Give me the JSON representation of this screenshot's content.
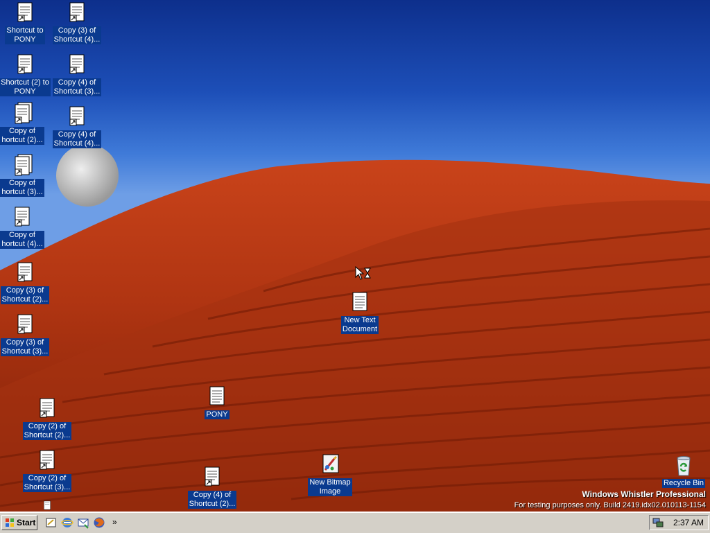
{
  "desktop": {
    "icons": [
      {
        "line1": "Shortcut to",
        "line2": "PONY"
      },
      {
        "line1": "Copy (3) of",
        "line2": "Shortcut (4)..."
      },
      {
        "line1": "Shortcut (2) to",
        "line2": "PONY"
      },
      {
        "line1": "Copy (4) of",
        "line2": "Shortcut (3)..."
      },
      {
        "line1": "Copy of",
        "line2": "hortcut (2)..."
      },
      {
        "line1": "Copy (4) of",
        "line2": "Shortcut (4)..."
      },
      {
        "line1": "Copy of",
        "line2": "hortcut (3)..."
      },
      {
        "line1": "Copy of",
        "line2": "hortcut (4)..."
      },
      {
        "line1": "Copy (3) of",
        "line2": "Shortcut (2)..."
      },
      {
        "line1": "Copy (3) of",
        "line2": "Shortcut (3)..."
      },
      {
        "line1": "Copy (2) of",
        "line2": "Shortcut (2)..."
      },
      {
        "line1": "Copy (2) of",
        "line2": "Shortcut (3)..."
      },
      {
        "line1": "PONY",
        "line2": ""
      },
      {
        "line1": "Copy (4) of",
        "line2": "Shortcut (2)..."
      },
      {
        "line1": "New Text",
        "line2": "Document"
      },
      {
        "line1": "New Bitmap",
        "line2": "Image"
      },
      {
        "line1": "Recycle Bin",
        "line2": ""
      }
    ],
    "watermark": {
      "title": "Windows Whistler Professional",
      "subtitle": "For testing purposes only. Build 2419.idx02.010113-1154"
    }
  },
  "taskbar": {
    "start_label": "Start",
    "quick_launch": [
      "show-desktop-icon",
      "internet-explorer-icon",
      "outlook-express-icon",
      "firefox-icon"
    ],
    "overflow_label": "»",
    "clock": "2:37 AM"
  },
  "colors": {
    "sky": "#1d4fb8",
    "dune": "#b8360f",
    "label_bg": "#0a3a8f",
    "taskbar": "#d4d0c8"
  }
}
